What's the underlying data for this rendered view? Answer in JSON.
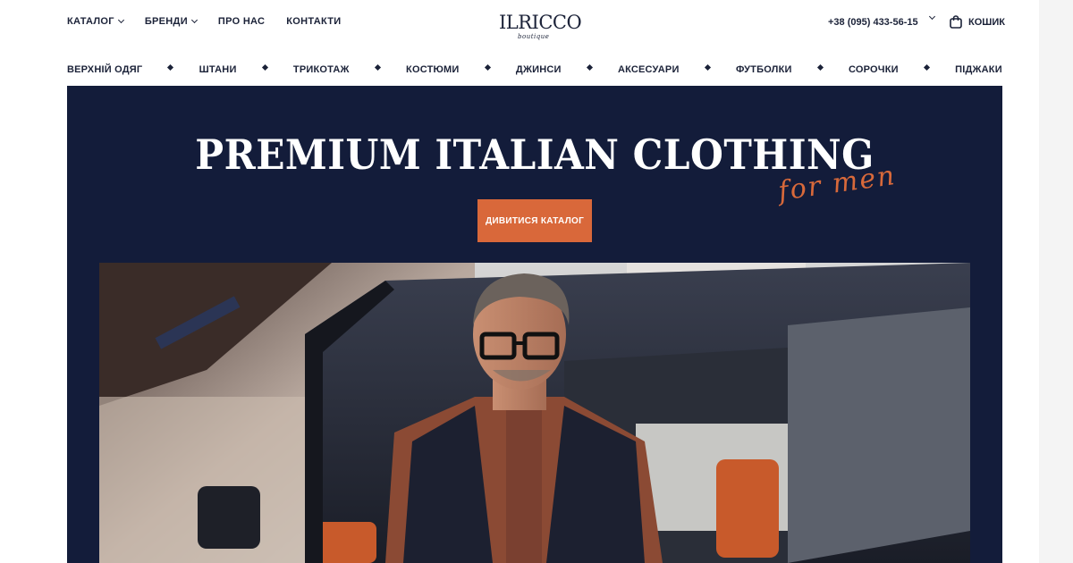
{
  "header": {
    "nav": [
      {
        "label": "КАТАЛОГ",
        "has_dropdown": true
      },
      {
        "label": "БРЕНДИ",
        "has_dropdown": true
      },
      {
        "label": "ПРО НАС",
        "has_dropdown": false
      },
      {
        "label": "КОНТАКТИ",
        "has_dropdown": false
      }
    ],
    "logo": {
      "main": "ILRICCO",
      "sub": "boutique"
    },
    "phone": "+38 (095) 433-56-15",
    "cart_label": "КОШИК"
  },
  "categories": [
    "ВЕРХНІЙ ОДЯГ",
    "ШТАНИ",
    "ТРИКОТАЖ",
    "КОСТЮМИ",
    "ДЖИНСИ",
    "АКСЕСУАРИ",
    "ФУТБОЛКИ",
    "СОРОЧКИ",
    "ПІДЖАКИ"
  ],
  "hero": {
    "title": "PREMIUM ITALIAN CLOTHING",
    "script": "for men",
    "button_label": "ДИВИТИСЯ КАТАЛОГ"
  },
  "colors": {
    "navy": "#131c3a",
    "accent": "#d9683a",
    "text": "#1b2238"
  },
  "icons": {
    "dropdown": "chevron-down-icon",
    "cart": "shopping-bag-icon",
    "separator": "diamond-icon"
  }
}
